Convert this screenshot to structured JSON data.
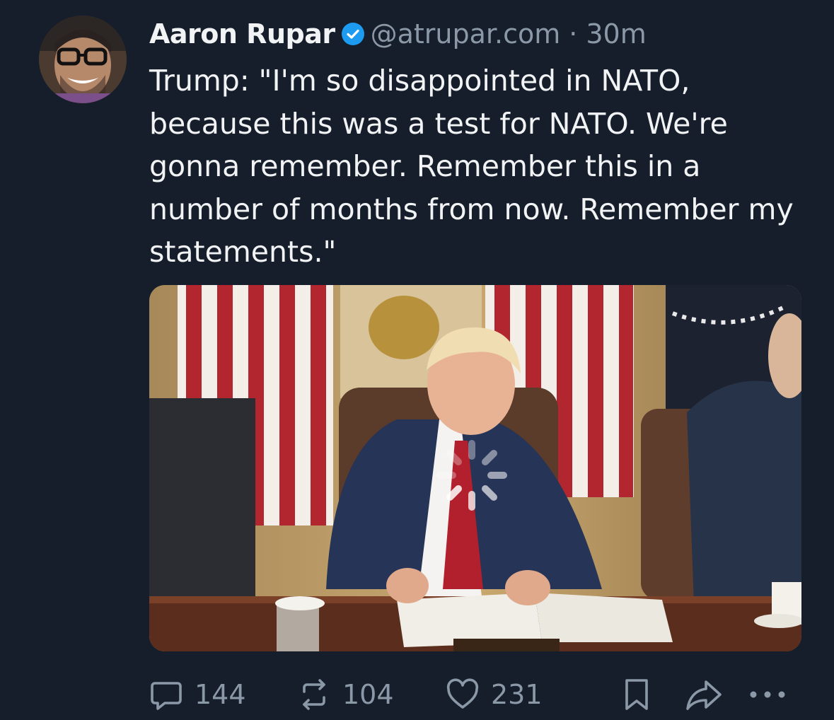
{
  "post": {
    "author_name": "Aaron Rupar",
    "handle": "@atrupar.com",
    "separator": "·",
    "timestamp": "30m",
    "text": "Trump: \"I'm so disappointed in NATO, because this was a test for NATO. We're gonna remember. Remember this in a number of months from now. Remember my statements.\"",
    "verified": true
  },
  "media": {
    "kind": "video",
    "state": "loading"
  },
  "actions": {
    "reply_count": "144",
    "repost_count": "104",
    "like_count": "231"
  },
  "icons": {
    "reply": "reply-icon",
    "repost": "repost-icon",
    "like": "like-icon",
    "bookmark": "bookmark-icon",
    "share": "share-icon",
    "more": "more-icon"
  },
  "colors": {
    "background": "#161e2b",
    "text": "#f1f3f5",
    "muted": "#8b98a7",
    "verified": "#1d9bf0"
  }
}
